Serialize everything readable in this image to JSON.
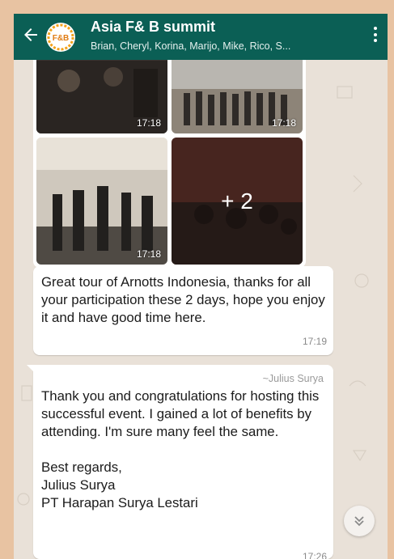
{
  "header": {
    "title": "Asia F& B summit",
    "subtitle": "Brian, Cheryl, Korina, Marijo, Mike, Rico, S...",
    "avatar_text": "F&B"
  },
  "album": {
    "times": [
      "17:18",
      "17:18",
      "17:18"
    ],
    "more_count": "+ 2"
  },
  "messages": [
    {
      "text": "Great tour of Arnotts Indonesia, thanks for all your participation these 2 days, hope you enjoy it and have good time here.",
      "time": "17:19"
    },
    {
      "sender": "~Julius Surya",
      "text": "Thank you and congratulations for hosting this successful event. I gained a lot of benefits by attending. I'm sure many feel the same.\n\nBest regards,\nJulius Surya\nPT Harapan Surya Lestari",
      "time": "17:26"
    }
  ],
  "colors": {
    "header": "#0b5f55",
    "chat_bg": "#e9e1d8",
    "frame": "#e8c3a2"
  }
}
